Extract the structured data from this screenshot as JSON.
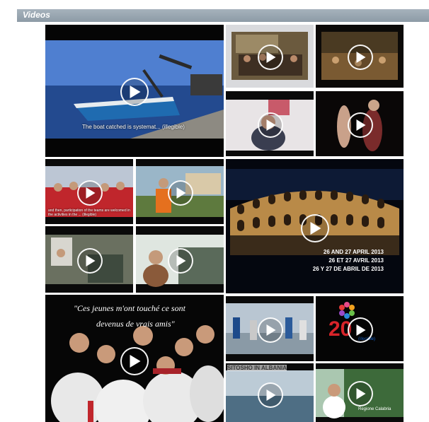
{
  "section": {
    "title": "Videos"
  },
  "videos": [
    {
      "caption": "The boat catched is systemat... (illegible)"
    },
    {
      "caption": ""
    },
    {
      "caption": ""
    },
    {
      "caption": ""
    },
    {
      "caption": ""
    },
    {
      "caption": "and then, participation of the teams are welcomed in the activities in the ... (illegible)"
    },
    {
      "caption": ""
    },
    {
      "caption_lines": [
        "26 AND 27 APRIL 2013",
        "26 ET 27 AVRIL 2013",
        "26 Y 27 DE ABRIL DE 2013"
      ]
    },
    {
      "caption": ""
    },
    {
      "caption": ""
    },
    {
      "quote_lines": [
        "\"Ces jeunes m'ont touché ce sont",
        "devenus de vrais amis\""
      ]
    },
    {
      "caption": ""
    },
    {
      "logo_digits": "20",
      "caption": "(illegible)"
    },
    {
      "overlay_text": "SITOSHO IN ALBANIA"
    },
    {
      "caption": "Regione Calabria"
    }
  ],
  "colors": {
    "section_bar": "#98a5b0",
    "tile_bg": "#050505",
    "play_icon": "#ffffff"
  },
  "icons": {
    "play": "play-button-icon"
  }
}
